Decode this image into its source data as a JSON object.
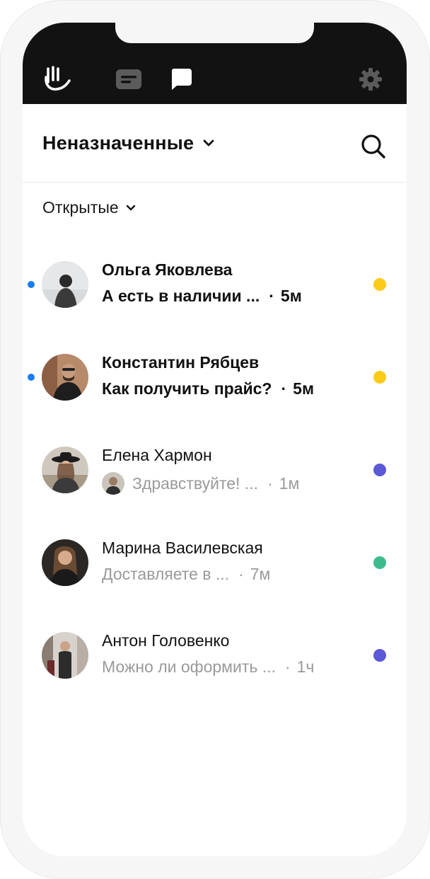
{
  "header": {
    "title": "Неназначенные",
    "filter": "Открытые"
  },
  "topbar": {
    "icons": [
      "hand-icon",
      "inbox-icon",
      "chat-bubble-icon",
      "gear-icon"
    ]
  },
  "conversations": [
    {
      "name": "Ольга Яковлева",
      "preview": "А есть в наличии ...",
      "separator": "·",
      "time": "5м",
      "unread": true,
      "status_color": "#fccb1a"
    },
    {
      "name": "Константин Рябцев",
      "preview": "Как получить прайс?",
      "separator": "·",
      "time": "5м",
      "unread": true,
      "status_color": "#fccb1a"
    },
    {
      "name": "Елена Хармон",
      "preview": "Здравствуйте! ...",
      "separator": "·",
      "time": "1м",
      "unread": false,
      "status_color": "#5c59d6"
    },
    {
      "name": "Марина Василевская",
      "preview": "Доставляете в ...",
      "separator": "·",
      "time": "7м",
      "unread": false,
      "status_color": "#3dbb8c"
    },
    {
      "name": "Антон Головенко",
      "preview": "Можно ли оформить ...",
      "separator": "·",
      "time": "1ч",
      "unread": false,
      "status_color": "#5c59d6"
    }
  ],
  "colors": {
    "topbar": "#121212",
    "unread_indicator": "#1a7cf2",
    "muted_text": "#9a9a9a"
  }
}
